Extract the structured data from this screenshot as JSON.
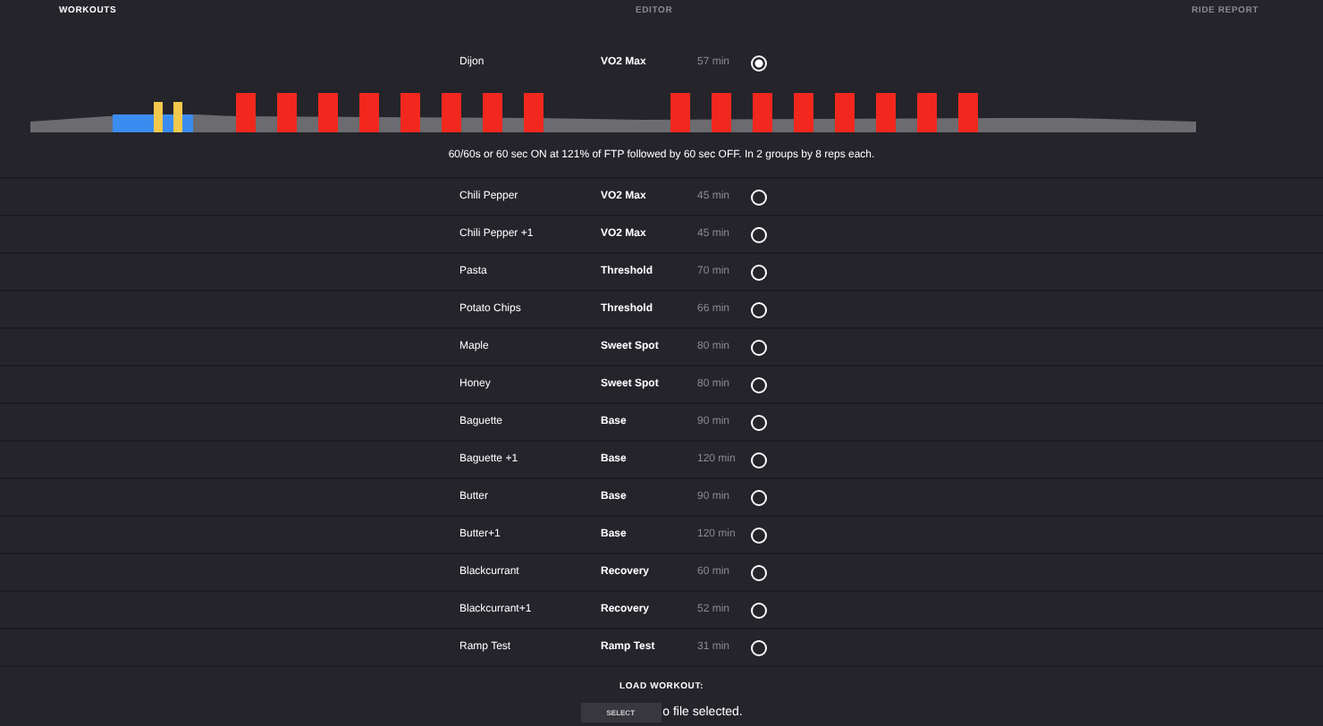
{
  "tabs": [
    {
      "label": "WORKOUTS",
      "selected": true
    },
    {
      "label": "EDITOR",
      "selected": false
    },
    {
      "label": "RIDE REPORT",
      "selected": false
    }
  ],
  "workouts": [
    {
      "name": "Dijon",
      "category": "VO2 Max",
      "duration": "57 min",
      "selected": true,
      "description": "60/60s or 60 sec ON at 121% of FTP followed by 60 sec OFF. In 2 groups by 8 reps each."
    },
    {
      "name": "Chili Pepper",
      "category": "VO2 Max",
      "duration": "45 min",
      "selected": false
    },
    {
      "name": "Chili Pepper +1",
      "category": "VO2 Max",
      "duration": "45 min",
      "selected": false
    },
    {
      "name": "Pasta",
      "category": "Threshold",
      "duration": "70 min",
      "selected": false
    },
    {
      "name": "Potato Chips",
      "category": "Threshold",
      "duration": "66 min",
      "selected": false
    },
    {
      "name": "Maple",
      "category": "Sweet Spot",
      "duration": "80 min",
      "selected": false
    },
    {
      "name": "Honey",
      "category": "Sweet Spot",
      "duration": "80 min",
      "selected": false
    },
    {
      "name": "Baguette",
      "category": "Base",
      "duration": "90 min",
      "selected": false
    },
    {
      "name": "Baguette +1",
      "category": "Base",
      "duration": "120 min",
      "selected": false
    },
    {
      "name": "Butter",
      "category": "Base",
      "duration": "90 min",
      "selected": false
    },
    {
      "name": "Butter+1",
      "category": "Base",
      "duration": "120 min",
      "selected": false
    },
    {
      "name": "Blackcurrant",
      "category": "Recovery",
      "duration": "60 min",
      "selected": false
    },
    {
      "name": "Blackcurrant+1",
      "category": "Recovery",
      "duration": "52 min",
      "selected": false
    },
    {
      "name": "Ramp Test",
      "category": "Ramp Test",
      "duration": "31 min",
      "selected": false
    }
  ],
  "load_workout": {
    "label": "LOAD WORKOUT:",
    "button": "SELECT",
    "file_status": "o file selected."
  }
}
